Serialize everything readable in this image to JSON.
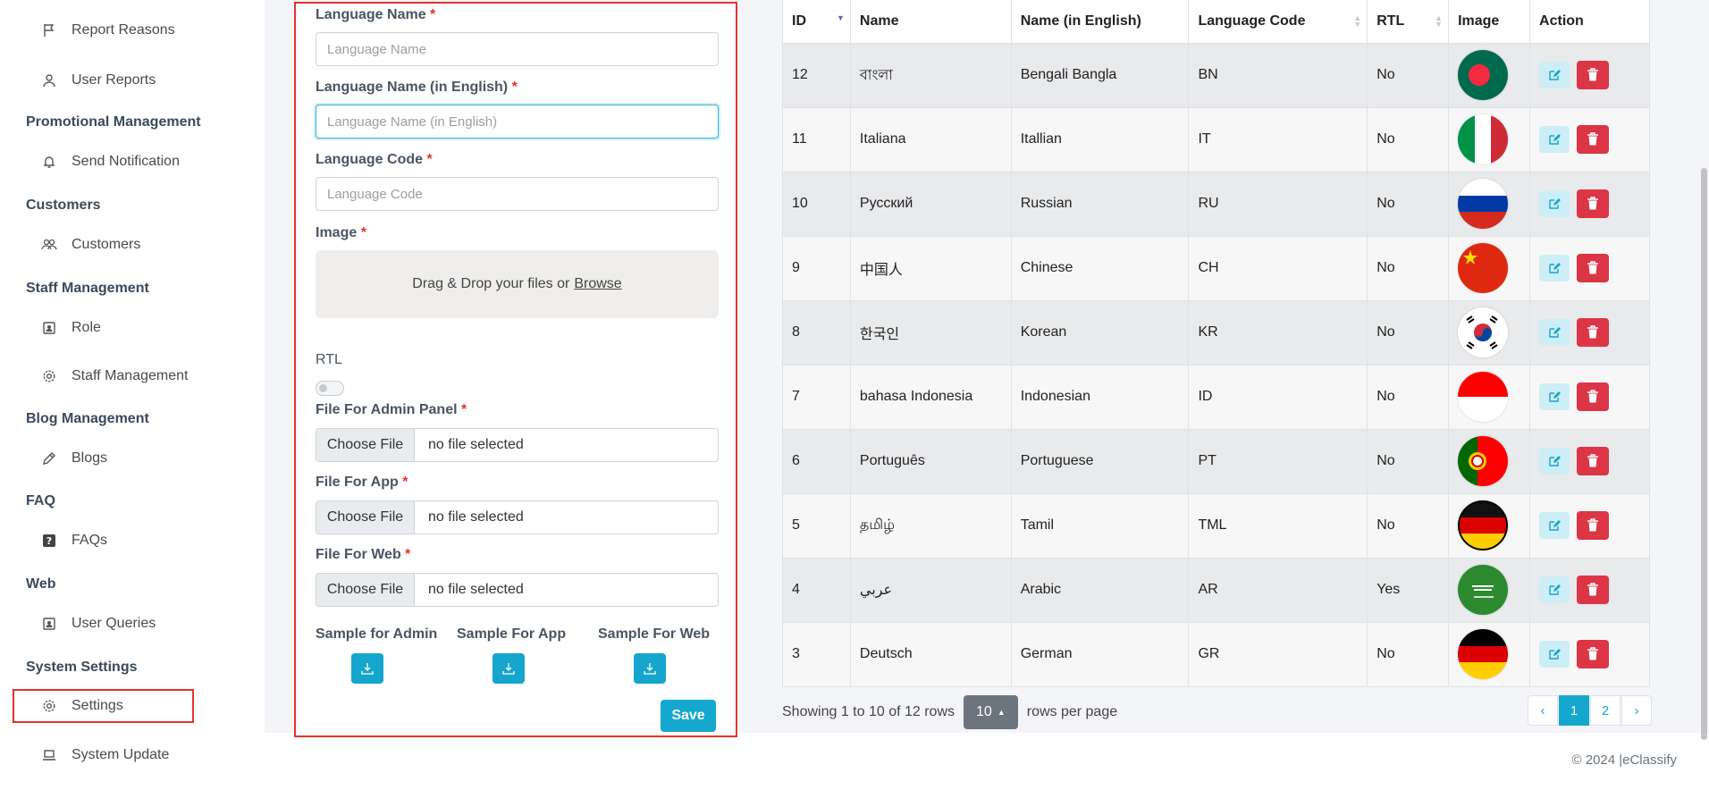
{
  "sidebar": {
    "items": [
      {
        "label": "Report Reasons",
        "icon": "flag-icon"
      },
      {
        "label": "User Reports",
        "icon": "user-icon"
      },
      {
        "label": "Send Notification",
        "icon": "bell-icon"
      },
      {
        "label": "Customers",
        "icon": "users-icon"
      },
      {
        "label": "Role",
        "icon": "id-badge-icon"
      },
      {
        "label": "Staff Management",
        "icon": "gear-icon"
      },
      {
        "label": "Blogs",
        "icon": "pencil-icon"
      },
      {
        "label": "FAQs",
        "icon": "question-icon"
      },
      {
        "label": "User Queries",
        "icon": "id-badge-icon"
      },
      {
        "label": "Settings",
        "icon": "gear-icon"
      },
      {
        "label": "System Update",
        "icon": "laptop-icon"
      }
    ],
    "headings": [
      "Promotional Management",
      "Customers",
      "Staff Management",
      "Blog Management",
      "FAQ",
      "Web",
      "System Settings"
    ]
  },
  "form": {
    "language_name_label": "Language Name",
    "language_name_placeholder": "Language Name",
    "language_name_en_label": "Language Name (in English)",
    "language_name_en_placeholder": "Language Name (in English)",
    "language_code_label": "Language Code",
    "language_code_placeholder": "Language Code",
    "image_label": "Image",
    "dropzone_text": "Drag & Drop your files or",
    "dropzone_browse": "Browse",
    "rtl_label": "RTL",
    "rtl_enabled": false,
    "file_admin_label": "File For Admin Panel",
    "file_app_label": "File For App",
    "file_web_label": "File For Web",
    "choose_file": "Choose File",
    "no_file": "no file selected",
    "required_mark": "*",
    "sample_admin": "Sample for Admin",
    "sample_app": "Sample For App",
    "sample_web": "Sample For Web",
    "save_label": "Save"
  },
  "table": {
    "columns": [
      "ID",
      "Name",
      "Name (in English)",
      "Language Code",
      "RTL",
      "Image",
      "Action"
    ],
    "rows": [
      {
        "id": "12",
        "name": "বাংলা",
        "name_en": "Bengali Bangla",
        "code": "BN",
        "rtl": "No",
        "flag": "bangladesh"
      },
      {
        "id": "11",
        "name": "Italiana",
        "name_en": "Itallian",
        "code": "IT",
        "rtl": "No",
        "flag": "italy"
      },
      {
        "id": "10",
        "name": "Русский",
        "name_en": "Russian",
        "code": "RU",
        "rtl": "No",
        "flag": "russia"
      },
      {
        "id": "9",
        "name": "中国人",
        "name_en": "Chinese",
        "code": "CH",
        "rtl": "No",
        "flag": "china"
      },
      {
        "id": "8",
        "name": "한국인",
        "name_en": "Korean",
        "code": "KR",
        "rtl": "No",
        "flag": "korea"
      },
      {
        "id": "7",
        "name": "bahasa Indonesia",
        "name_en": "Indonesian",
        "code": "ID",
        "rtl": "No",
        "flag": "indonesia"
      },
      {
        "id": "6",
        "name": "Português",
        "name_en": "Portuguese",
        "code": "PT",
        "rtl": "No",
        "flag": "portugal"
      },
      {
        "id": "5",
        "name": "தமிழ்",
        "name_en": "Tamil",
        "code": "TML",
        "rtl": "No",
        "flag": "tamil"
      },
      {
        "id": "4",
        "name": "عربي",
        "name_en": "Arabic",
        "code": "AR",
        "rtl": "Yes",
        "flag": "saudi"
      },
      {
        "id": "3",
        "name": "Deutsch",
        "name_en": "German",
        "code": "GR",
        "rtl": "No",
        "flag": "germany"
      }
    ]
  },
  "pagination": {
    "showing_text": "Showing 1 to 10 of 12 rows",
    "rows_per_page_value": "10",
    "rows_per_page_label": "rows per page",
    "pages": [
      "‹",
      "1",
      "2",
      "›"
    ],
    "current_page": "1"
  },
  "footer": {
    "copyright": "© 2024 |eClassify"
  },
  "colors": {
    "accent": "#14a8cf",
    "danger": "#dc3545",
    "highlight": "#e5322d"
  }
}
